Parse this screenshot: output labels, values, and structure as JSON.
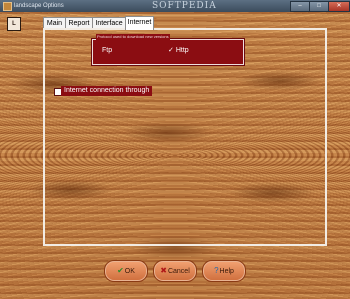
{
  "window": {
    "title": "landscape Options",
    "watermark": "SOFTPEDIA",
    "min_glyph": "–",
    "max_glyph": "□",
    "close_glyph": "✕"
  },
  "logo": {
    "glyph": "L"
  },
  "tabs": [
    {
      "label": "Main",
      "active": false
    },
    {
      "label": "Report",
      "active": false
    },
    {
      "label": "Interface",
      "active": false
    },
    {
      "label": "Internet",
      "active": true
    }
  ],
  "protocol": {
    "legend": "Protocol used to download new versions",
    "options": [
      {
        "label": "Ftp",
        "selected": false
      },
      {
        "label": "Http",
        "selected": true
      }
    ],
    "check_glyph": "✓"
  },
  "internet_connection": {
    "label": "Internet connection through",
    "checked": false
  },
  "buttons": {
    "ok": {
      "label": "OK",
      "icon_glyph": "✔"
    },
    "cancel": {
      "label": "Cancel",
      "icon_glyph": "✖"
    },
    "help": {
      "label": "Help",
      "icon_glyph": "?"
    }
  },
  "colors": {
    "option_box": "#8b0d12",
    "wood_base": "#b8763a",
    "button": "#e08a58",
    "titlebar": "#4b5d70"
  }
}
